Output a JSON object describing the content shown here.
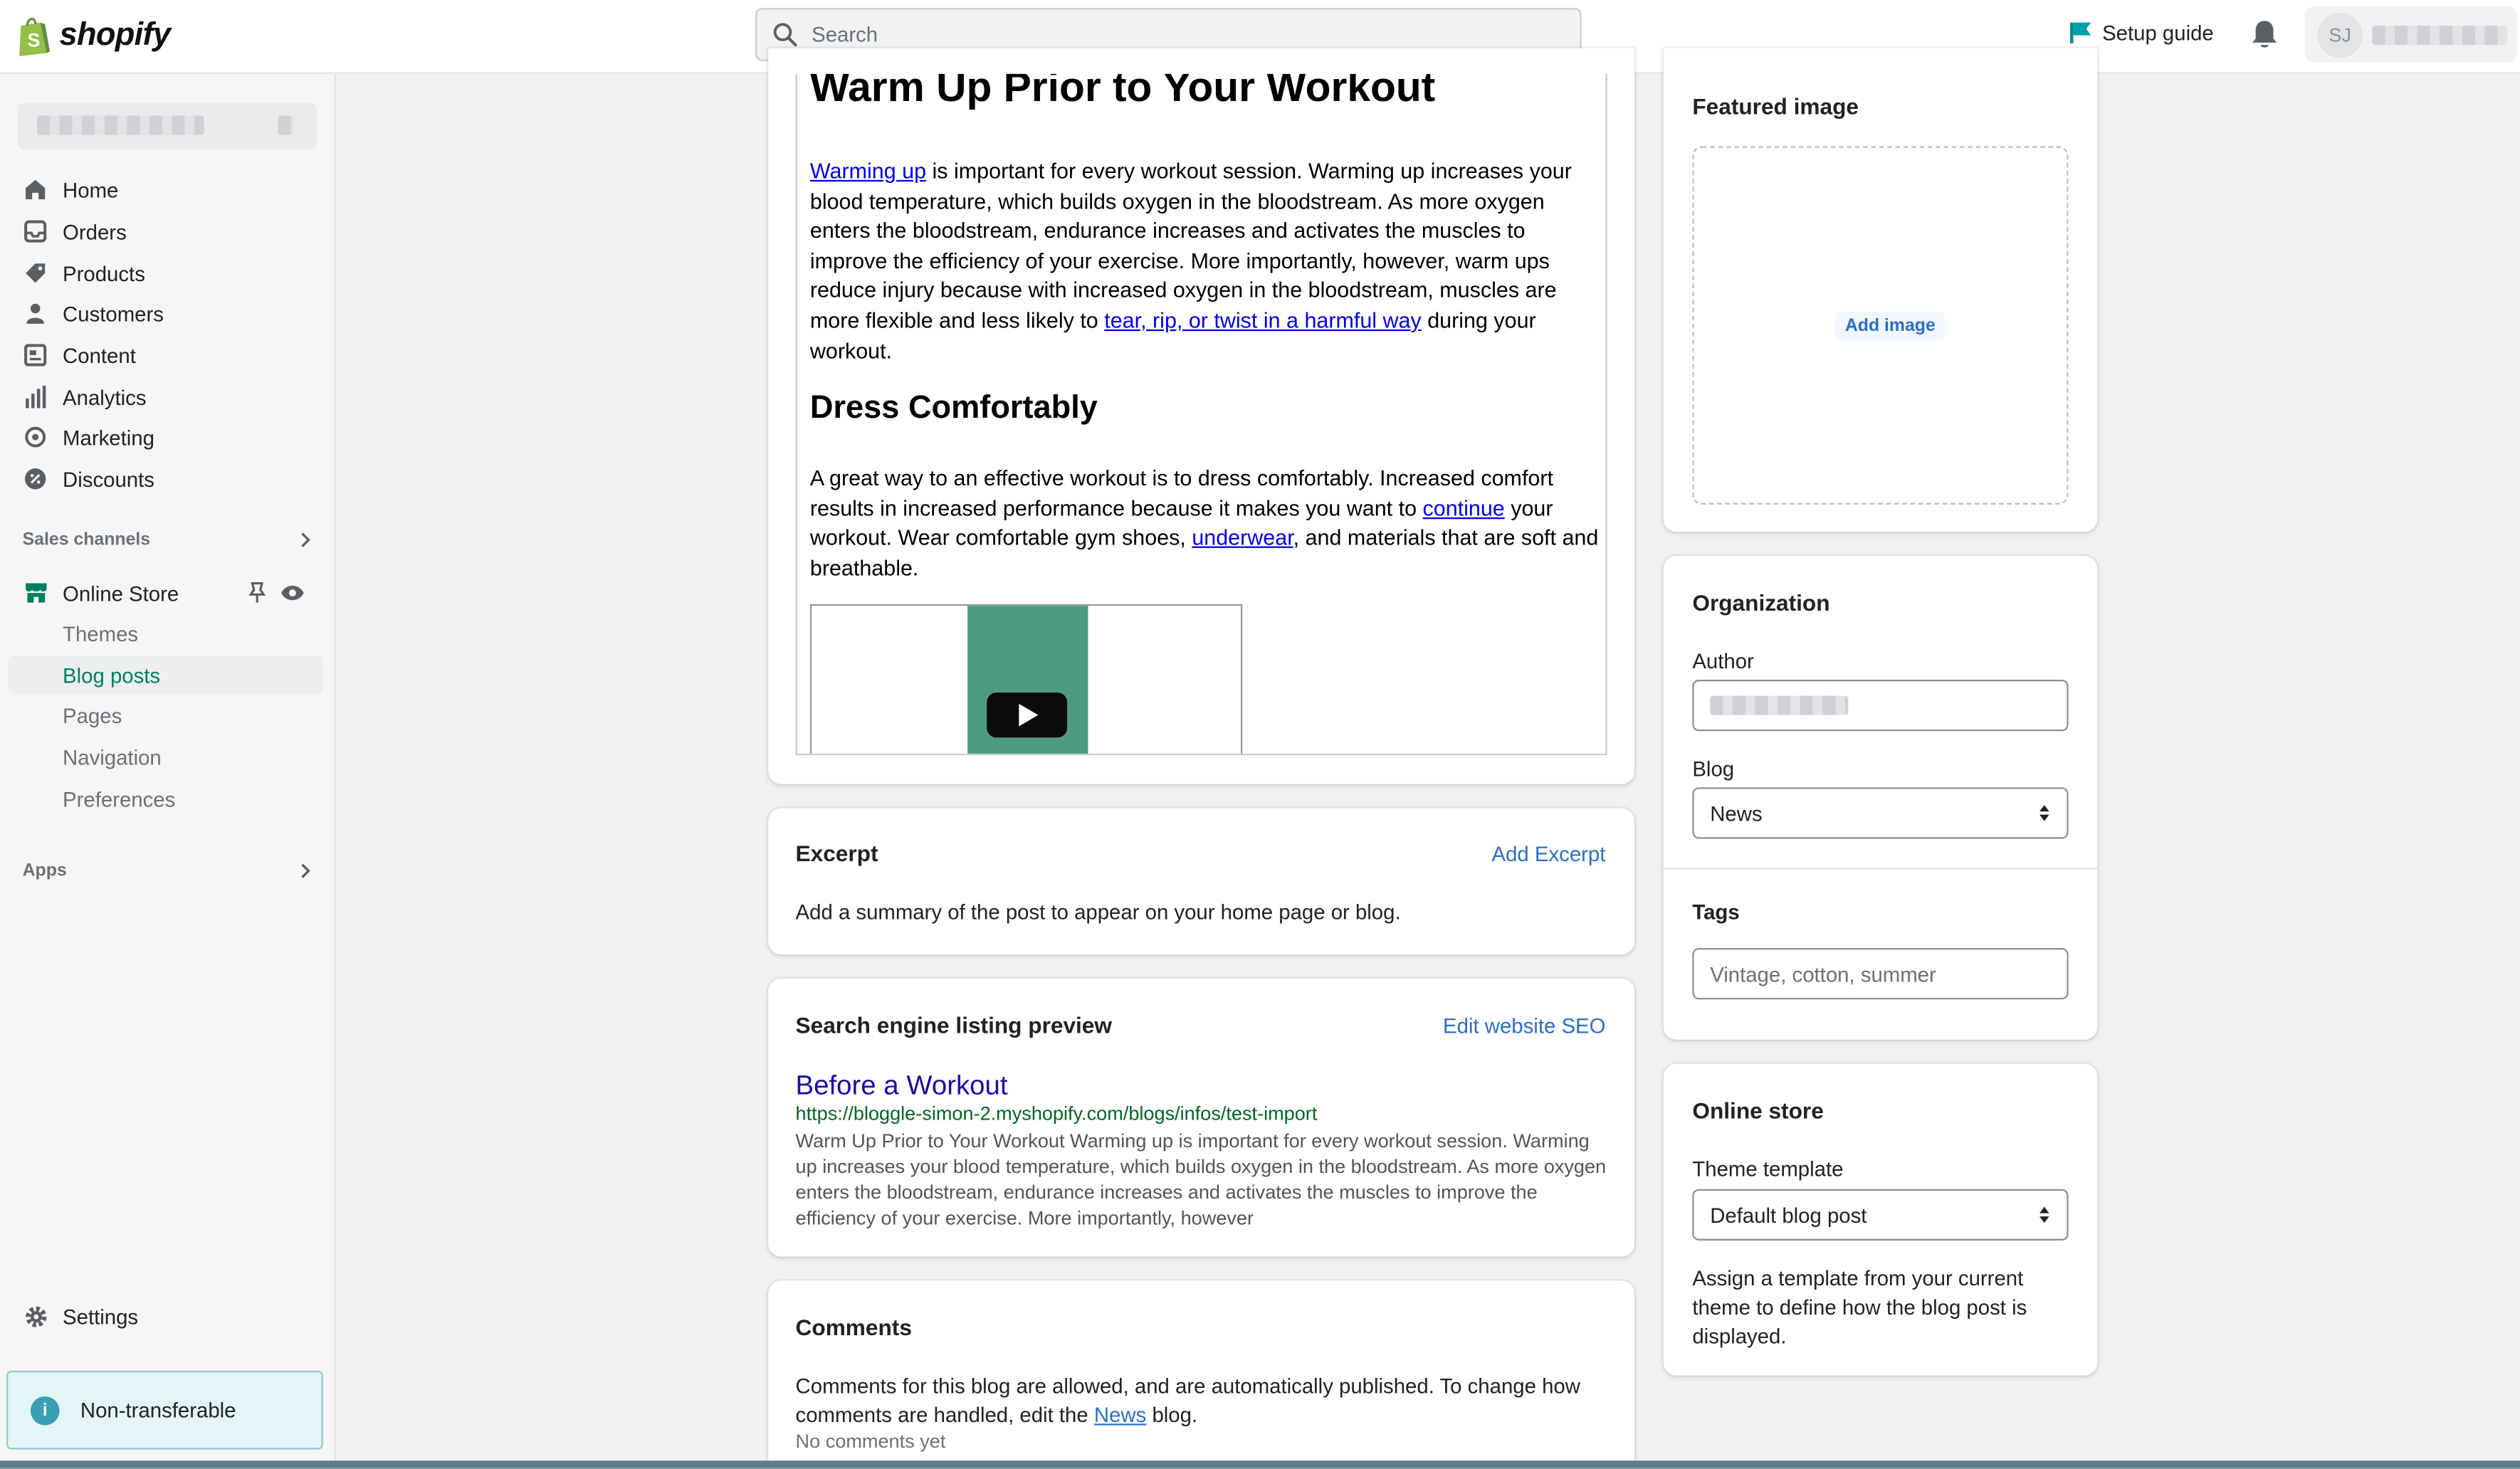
{
  "topbar": {
    "logo_text": "shopify",
    "search_placeholder": "Search",
    "setup_guide": "Setup guide",
    "avatar_initials": "SJ"
  },
  "sidebar": {
    "main_items": [
      {
        "label": "Home",
        "icon": "home-icon"
      },
      {
        "label": "Orders",
        "icon": "orders-icon"
      },
      {
        "label": "Products",
        "icon": "tag-icon"
      },
      {
        "label": "Customers",
        "icon": "person-icon"
      },
      {
        "label": "Content",
        "icon": "content-icon"
      },
      {
        "label": "Analytics",
        "icon": "bar-chart-icon"
      },
      {
        "label": "Marketing",
        "icon": "target-icon"
      },
      {
        "label": "Discounts",
        "icon": "discount-icon"
      }
    ],
    "sales_channels_label": "Sales channels",
    "online_store_label": "Online Store",
    "online_store_subitems": [
      "Themes",
      "Blog posts",
      "Pages",
      "Navigation",
      "Preferences"
    ],
    "active_subitem": "Blog posts",
    "apps_label": "Apps",
    "settings_label": "Settings",
    "banner_text": "Non-transferable"
  },
  "editor": {
    "heading1": "Warm Up Prior to Your Workout",
    "para1_link1": "Warming up",
    "para1_text1": " is important for every workout session. Warming up increases your blood temperature, which builds oxygen in the bloodstream. As more oxygen enters the bloodstream, endurance increases and activates the muscles to improve the efficiency of your exercise. More importantly, however, warm ups reduce injury because with increased oxygen in the bloodstream, muscles are more flexible and less likely to ",
    "para1_link2": "tear, rip, or twist in a harmful way",
    "para1_text2": " during your workout.",
    "heading2": "Dress Comfortably",
    "para2_text1": "A great way to an effective workout is to dress comfortably. Increased comfort results in increased performance because it makes you want to ",
    "para2_link1": "continue",
    "para2_text2": " your workout. Wear comfortable gym shoes, ",
    "para2_link2": "underwear",
    "para2_text3": ", and materials that are soft and breathable."
  },
  "excerpt": {
    "title": "Excerpt",
    "action": "Add Excerpt",
    "description": "Add a summary of the post to appear on your home page or blog."
  },
  "seo": {
    "title": "Search engine listing preview",
    "action": "Edit website SEO",
    "preview_title": "Before a Workout",
    "preview_url": "https://bloggle-simon-2.myshopify.com/blogs/infos/test-import",
    "preview_desc": "Warm Up Prior to Your Workout Warming up is important for every workout session. Warming up increases your blood temperature, which builds oxygen in the bloodstream. As more oxygen enters the bloodstream, endurance increases and activates the muscles to improve the efficiency of your exercise. More importantly, however"
  },
  "comments": {
    "title": "Comments",
    "text1": "Comments for this blog are allowed, and are automatically published. To change how comments are handled, edit the ",
    "link": "News",
    "text2": " blog.",
    "empty": "No comments yet"
  },
  "featured_image": {
    "title": "Featured image",
    "button": "Add image"
  },
  "organization": {
    "title": "Organization",
    "author_label": "Author",
    "blog_label": "Blog",
    "blog_value": "News",
    "tags_label": "Tags",
    "tags_placeholder": "Vintage, cotton, summer"
  },
  "online_store_card": {
    "title": "Online store",
    "theme_label": "Theme template",
    "theme_value": "Default blog post",
    "help": "Assign a template from your current theme to define how the blog post is displayed."
  },
  "colors": {
    "accent_green": "#008060",
    "link_blue": "#2c6ecb",
    "banner_bg": "#e4f5f7"
  }
}
